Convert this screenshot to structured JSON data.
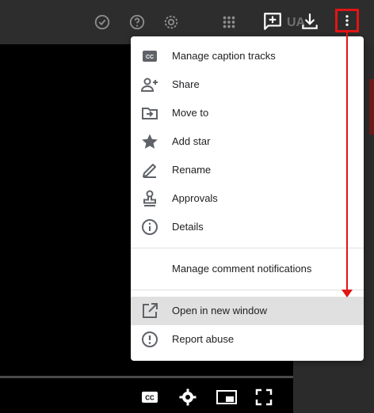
{
  "menu": {
    "items": [
      {
        "label": "Manage caption tracks",
        "icon": "closed-captions-icon"
      },
      {
        "label": "Share",
        "icon": "add-person-icon"
      },
      {
        "label": "Move to",
        "icon": "move-to-folder-icon"
      },
      {
        "label": "Add star",
        "icon": "star-icon"
      },
      {
        "label": "Rename",
        "icon": "pencil-icon"
      },
      {
        "label": "Approvals",
        "icon": "stamp-icon"
      },
      {
        "label": "Details",
        "icon": "info-icon"
      },
      {
        "label": "Manage comment notifications",
        "icon": ""
      },
      {
        "label": "Open in new window",
        "icon": "open-in-new-icon"
      },
      {
        "label": "Report abuse",
        "icon": "report-icon"
      }
    ],
    "highlighted": "Open in new window"
  },
  "topbar": {
    "partial_text": "UA"
  },
  "colors": {
    "annotation": "#e21515",
    "highlight": "#e0e0e0"
  }
}
